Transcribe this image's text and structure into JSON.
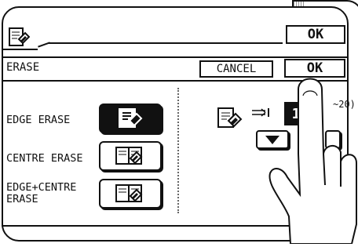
{
  "top_bar": {
    "ok_label": "OK"
  },
  "erase_bar": {
    "title": "ERASE",
    "cancel_label": "CANCEL",
    "ok_label": "OK"
  },
  "options": [
    {
      "label": "EDGE ERASE",
      "selected": true
    },
    {
      "label": "CENTRE ERASE",
      "selected": false
    },
    {
      "label": "EDGE+CENTRE\nERASE",
      "selected": false
    }
  ],
  "width_setting": {
    "value": "1",
    "range_hint": "~20)"
  }
}
